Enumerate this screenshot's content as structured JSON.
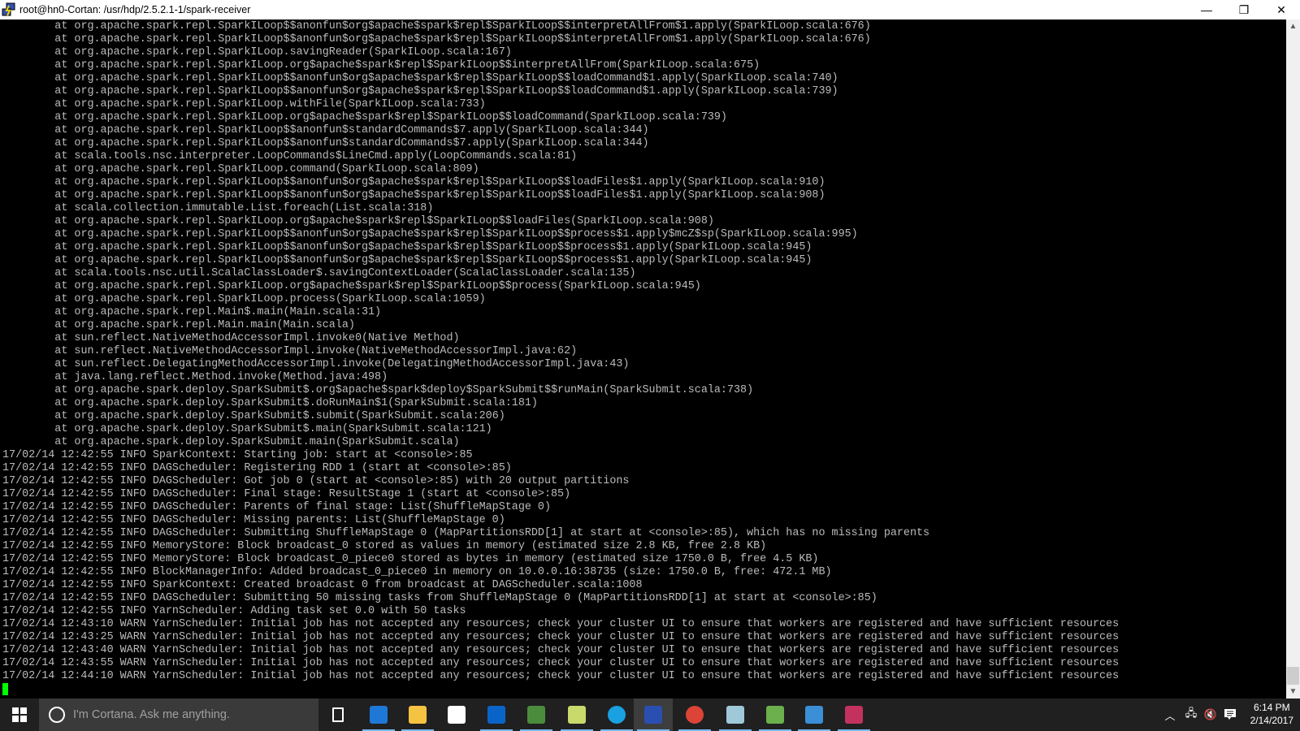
{
  "window": {
    "title": "root@hn0-Cortan: /usr/hdp/2.5.2.1-1/spark-receiver",
    "minimize": "—",
    "restore": "❐",
    "close": "✕"
  },
  "terminal": {
    "lines": [
      "\tat org.apache.spark.repl.SparkILoop$$anonfun$org$apache$spark$repl$SparkILoop$$interpretAllFrom$1.apply(SparkILoop.scala:676)",
      "\tat org.apache.spark.repl.SparkILoop$$anonfun$org$apache$spark$repl$SparkILoop$$interpretAllFrom$1.apply(SparkILoop.scala:676)",
      "\tat org.apache.spark.repl.SparkILoop.savingReader(SparkILoop.scala:167)",
      "\tat org.apache.spark.repl.SparkILoop.org$apache$spark$repl$SparkILoop$$interpretAllFrom(SparkILoop.scala:675)",
      "\tat org.apache.spark.repl.SparkILoop$$anonfun$org$apache$spark$repl$SparkILoop$$loadCommand$1.apply(SparkILoop.scala:740)",
      "\tat org.apache.spark.repl.SparkILoop$$anonfun$org$apache$spark$repl$SparkILoop$$loadCommand$1.apply(SparkILoop.scala:739)",
      "\tat org.apache.spark.repl.SparkILoop.withFile(SparkILoop.scala:733)",
      "\tat org.apache.spark.repl.SparkILoop.org$apache$spark$repl$SparkILoop$$loadCommand(SparkILoop.scala:739)",
      "\tat org.apache.spark.repl.SparkILoop$$anonfun$standardCommands$7.apply(SparkILoop.scala:344)",
      "\tat org.apache.spark.repl.SparkILoop$$anonfun$standardCommands$7.apply(SparkILoop.scala:344)",
      "\tat scala.tools.nsc.interpreter.LoopCommands$LineCmd.apply(LoopCommands.scala:81)",
      "\tat org.apache.spark.repl.SparkILoop.command(SparkILoop.scala:809)",
      "\tat org.apache.spark.repl.SparkILoop$$anonfun$org$apache$spark$repl$SparkILoop$$loadFiles$1.apply(SparkILoop.scala:910)",
      "\tat org.apache.spark.repl.SparkILoop$$anonfun$org$apache$spark$repl$SparkILoop$$loadFiles$1.apply(SparkILoop.scala:908)",
      "\tat scala.collection.immutable.List.foreach(List.scala:318)",
      "\tat org.apache.spark.repl.SparkILoop.org$apache$spark$repl$SparkILoop$$loadFiles(SparkILoop.scala:908)",
      "\tat org.apache.spark.repl.SparkILoop$$anonfun$org$apache$spark$repl$SparkILoop$$process$1.apply$mcZ$sp(SparkILoop.scala:995)",
      "\tat org.apache.spark.repl.SparkILoop$$anonfun$org$apache$spark$repl$SparkILoop$$process$1.apply(SparkILoop.scala:945)",
      "\tat org.apache.spark.repl.SparkILoop$$anonfun$org$apache$spark$repl$SparkILoop$$process$1.apply(SparkILoop.scala:945)",
      "\tat scala.tools.nsc.util.ScalaClassLoader$.savingContextLoader(ScalaClassLoader.scala:135)",
      "\tat org.apache.spark.repl.SparkILoop.org$apache$spark$repl$SparkILoop$$process(SparkILoop.scala:945)",
      "\tat org.apache.spark.repl.SparkILoop.process(SparkILoop.scala:1059)",
      "\tat org.apache.spark.repl.Main$.main(Main.scala:31)",
      "\tat org.apache.spark.repl.Main.main(Main.scala)",
      "\tat sun.reflect.NativeMethodAccessorImpl.invoke0(Native Method)",
      "\tat sun.reflect.NativeMethodAccessorImpl.invoke(NativeMethodAccessorImpl.java:62)",
      "\tat sun.reflect.DelegatingMethodAccessorImpl.invoke(DelegatingMethodAccessorImpl.java:43)",
      "\tat java.lang.reflect.Method.invoke(Method.java:498)",
      "\tat org.apache.spark.deploy.SparkSubmit$.org$apache$spark$deploy$SparkSubmit$$runMain(SparkSubmit.scala:738)",
      "\tat org.apache.spark.deploy.SparkSubmit$.doRunMain$1(SparkSubmit.scala:181)",
      "\tat org.apache.spark.deploy.SparkSubmit$.submit(SparkSubmit.scala:206)",
      "\tat org.apache.spark.deploy.SparkSubmit$.main(SparkSubmit.scala:121)",
      "\tat org.apache.spark.deploy.SparkSubmit.main(SparkSubmit.scala)",
      "17/02/14 12:42:55 INFO SparkContext: Starting job: start at <console>:85",
      "17/02/14 12:42:55 INFO DAGScheduler: Registering RDD 1 (start at <console>:85)",
      "17/02/14 12:42:55 INFO DAGScheduler: Got job 0 (start at <console>:85) with 20 output partitions",
      "17/02/14 12:42:55 INFO DAGScheduler: Final stage: ResultStage 1 (start at <console>:85)",
      "17/02/14 12:42:55 INFO DAGScheduler: Parents of final stage: List(ShuffleMapStage 0)",
      "17/02/14 12:42:55 INFO DAGScheduler: Missing parents: List(ShuffleMapStage 0)",
      "17/02/14 12:42:55 INFO DAGScheduler: Submitting ShuffleMapStage 0 (MapPartitionsRDD[1] at start at <console>:85), which has no missing parents",
      "17/02/14 12:42:55 INFO MemoryStore: Block broadcast_0 stored as values in memory (estimated size 2.8 KB, free 2.8 KB)",
      "17/02/14 12:42:55 INFO MemoryStore: Block broadcast_0_piece0 stored as bytes in memory (estimated size 1750.0 B, free 4.5 KB)",
      "17/02/14 12:42:55 INFO BlockManagerInfo: Added broadcast_0_piece0 in memory on 10.0.0.16:38735 (size: 1750.0 B, free: 472.1 MB)",
      "17/02/14 12:42:55 INFO SparkContext: Created broadcast 0 from broadcast at DAGScheduler.scala:1008",
      "17/02/14 12:42:55 INFO DAGScheduler: Submitting 50 missing tasks from ShuffleMapStage 0 (MapPartitionsRDD[1] at start at <console>:85)",
      "17/02/14 12:42:55 INFO YarnScheduler: Adding task set 0.0 with 50 tasks",
      "17/02/14 12:43:10 WARN YarnScheduler: Initial job has not accepted any resources; check your cluster UI to ensure that workers are registered and have sufficient resources",
      "17/02/14 12:43:25 WARN YarnScheduler: Initial job has not accepted any resources; check your cluster UI to ensure that workers are registered and have sufficient resources",
      "17/02/14 12:43:40 WARN YarnScheduler: Initial job has not accepted any resources; check your cluster UI to ensure that workers are registered and have sufficient resources",
      "17/02/14 12:43:55 WARN YarnScheduler: Initial job has not accepted any resources; check your cluster UI to ensure that workers are registered and have sufficient resources",
      "17/02/14 12:44:10 WARN YarnScheduler: Initial job has not accepted any resources; check your cluster UI to ensure that workers are registered and have sufficient resources"
    ]
  },
  "taskbar": {
    "search_placeholder": "I'm Cortana. Ask me anything.",
    "apps": [
      {
        "name": "task-view",
        "color": "#ffffff"
      },
      {
        "name": "edge",
        "color": "#1e78d7"
      },
      {
        "name": "file-explorer",
        "color": "#f5c342"
      },
      {
        "name": "store",
        "color": "#ffffff"
      },
      {
        "name": "outlook",
        "color": "#0a64c8"
      },
      {
        "name": "remote-tool",
        "color": "#4a8c3c"
      },
      {
        "name": "sticky-folders",
        "color": "#c9d96b"
      },
      {
        "name": "skype",
        "color": "#1aa1e1"
      },
      {
        "name": "putty",
        "color": "#2a4fb0"
      },
      {
        "name": "chrome",
        "color": "#db4437"
      },
      {
        "name": "notes",
        "color": "#9fc9d9"
      },
      {
        "name": "notepad",
        "color": "#6bb04c"
      },
      {
        "name": "control-panel",
        "color": "#3a8fd6"
      },
      {
        "name": "intellij",
        "color": "#c3325f"
      }
    ],
    "time": "6:14 PM",
    "date": "2/14/2017"
  }
}
